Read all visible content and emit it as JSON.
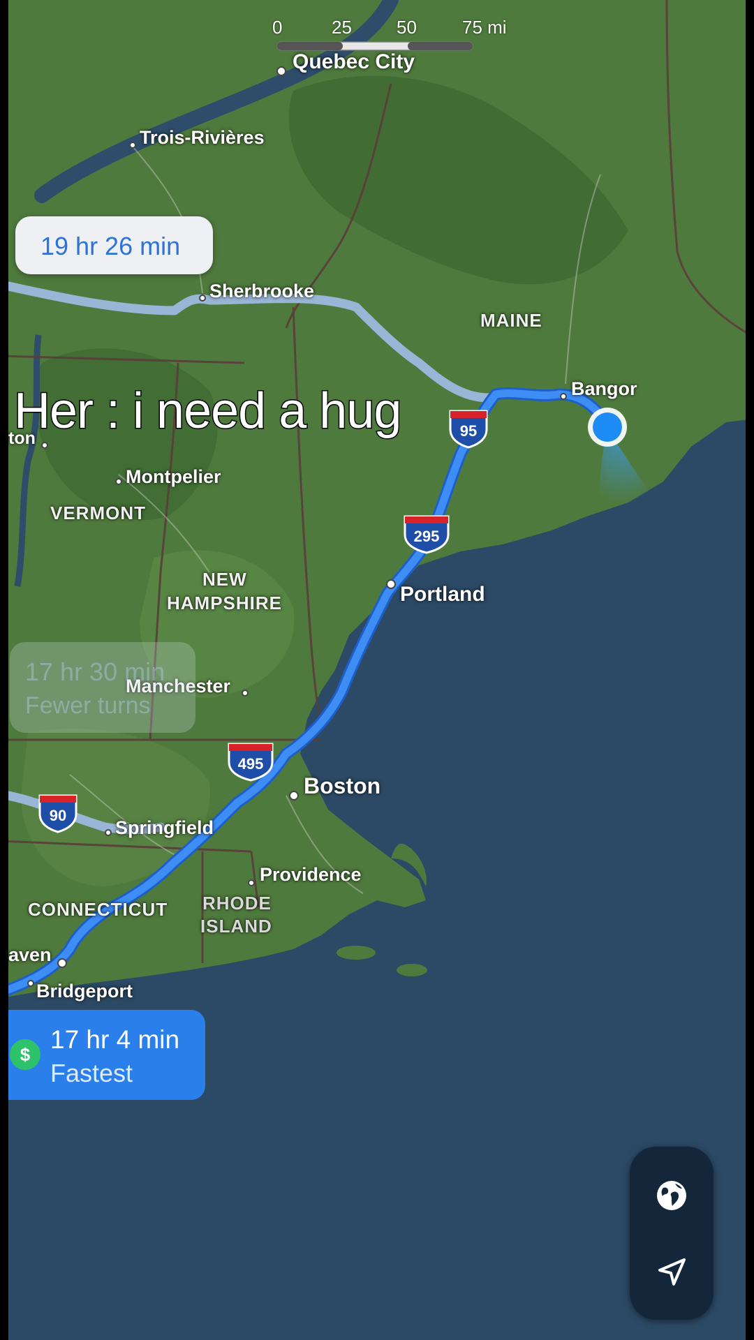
{
  "scale": {
    "zero": "0",
    "mark1": "25",
    "mark2": "50",
    "mark3": "75 mi"
  },
  "cities": {
    "quebec": "Quebec City",
    "trois_rivieres": "Trois-Rivières",
    "sherbrooke": "Sherbrooke",
    "bangor": "Bangor",
    "burlington_partial": "ton",
    "montpelier": "Montpelier",
    "portland": "Portland",
    "manchester": "Manchester",
    "boston": "Boston",
    "springfield": "Springfield",
    "providence": "Providence",
    "new_haven_partial": "aven",
    "bridgeport": "Bridgeport"
  },
  "states": {
    "maine": "MAINE",
    "vermont": "VERMONT",
    "new_hampshire_1": "NEW",
    "new_hampshire_2": "HAMPSHIRE",
    "connecticut": "CONNECTICUT",
    "rhode_island_1": "RHODE",
    "rhode_island_2": "ISLAND"
  },
  "shields": {
    "i95": "95",
    "i295": "295",
    "i495": "495",
    "i90": "90"
  },
  "routes": {
    "alt_route_time": "19 hr 26 min",
    "faded_route_time": "17 hr 30 min",
    "faded_route_desc": "Fewer turns",
    "fastest_time": "17 hr 4 min",
    "fastest_label": "Fastest",
    "toll_symbol": "$"
  },
  "overlay": {
    "caption": "Her : i need a hug"
  },
  "controls": {
    "globe_icon": "globe-icon",
    "location_icon": "location-arrow-icon"
  },
  "colors": {
    "route_primary": "#2f7ff0",
    "route_alt": "#9db8d8",
    "water": "#2a4a66",
    "land": "#4d7a3c"
  }
}
